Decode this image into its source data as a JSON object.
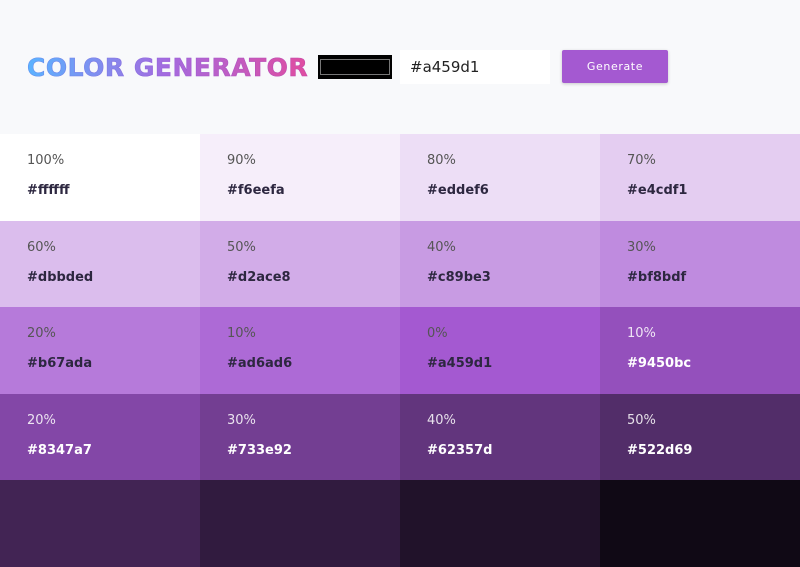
{
  "header": {
    "title": "COLOR GENERATOR",
    "picker_color": "#000000",
    "hex_value": "#a459d1",
    "generate_label": "Generate"
  },
  "swatches": [
    {
      "percent": "100%",
      "hex": "#ffffff",
      "color": "#ffffff",
      "dark": false
    },
    {
      "percent": "90%",
      "hex": "#f6eefa",
      "color": "#f6eefa",
      "dark": false
    },
    {
      "percent": "80%",
      "hex": "#eddef6",
      "color": "#eddef6",
      "dark": false
    },
    {
      "percent": "70%",
      "hex": "#e4cdf1",
      "color": "#e4cdf1",
      "dark": false
    },
    {
      "percent": "60%",
      "hex": "#dbbded",
      "color": "#dbbded",
      "dark": false
    },
    {
      "percent": "50%",
      "hex": "#d2ace8",
      "color": "#d2ace8",
      "dark": false
    },
    {
      "percent": "40%",
      "hex": "#c89be3",
      "color": "#c89be3",
      "dark": false
    },
    {
      "percent": "30%",
      "hex": "#bf8bdf",
      "color": "#bf8bdf",
      "dark": false
    },
    {
      "percent": "20%",
      "hex": "#b67ada",
      "color": "#b67ada",
      "dark": false
    },
    {
      "percent": "10%",
      "hex": "#ad6ad6",
      "color": "#ad6ad6",
      "dark": false
    },
    {
      "percent": "0%",
      "hex": "#a459d1",
      "color": "#a459d1",
      "dark": false
    },
    {
      "percent": "10%",
      "hex": "#9450bc",
      "color": "#9450bc",
      "dark": true
    },
    {
      "percent": "20%",
      "hex": "#8347a7",
      "color": "#8347a7",
      "dark": true
    },
    {
      "percent": "30%",
      "hex": "#733e92",
      "color": "#733e92",
      "dark": true
    },
    {
      "percent": "40%",
      "hex": "#62357d",
      "color": "#62357d",
      "dark": true
    },
    {
      "percent": "50%",
      "hex": "#522d69",
      "color": "#522d69",
      "dark": true
    },
    {
      "percent": "",
      "hex": "",
      "color": "#422454",
      "dark": true
    },
    {
      "percent": "",
      "hex": "",
      "color": "#311b3f",
      "dark": true
    },
    {
      "percent": "",
      "hex": "",
      "color": "#21122a",
      "dark": true
    },
    {
      "percent": "",
      "hex": "",
      "color": "#100915",
      "dark": true
    }
  ]
}
